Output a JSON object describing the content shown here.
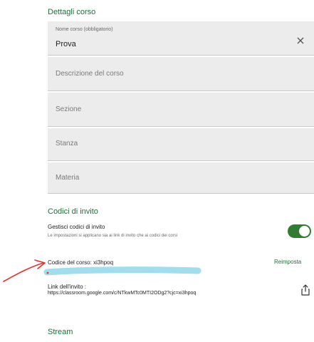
{
  "details": {
    "section_title": "Dettagli corso",
    "course_name_label": "Nome corso (obbligatorio)",
    "course_name_value": "Prova",
    "description_placeholder": "Descrizione del corso",
    "section_placeholder": "Sezione",
    "room_placeholder": "Stanza",
    "subject_placeholder": "Materia"
  },
  "invite": {
    "section_title": "Codici di invito",
    "manage_title": "Gestisci codici di invito",
    "manage_subtitle": "Le impostazioni si applicano sia ai link di invito che ai codici dei corsi",
    "manage_enabled": true,
    "course_code_label": "Codice del corso: xi3hpoq",
    "reset_label": "Reimposta",
    "link_title": "Link dell'invito :",
    "link_url": "https://classroom.google.com/c/NTkwMTc0MTI2ODg2?cjc=xi3hpoq"
  },
  "stream": {
    "section_title": "Stream"
  },
  "colors": {
    "accent_green": "#1e6e3a",
    "toggle_green": "#2e7d32",
    "annotation_red": "#e8312a",
    "annotation_cyan": "#8fd8ea"
  },
  "icons": {
    "clear": "close-icon",
    "share": "share-icon"
  }
}
